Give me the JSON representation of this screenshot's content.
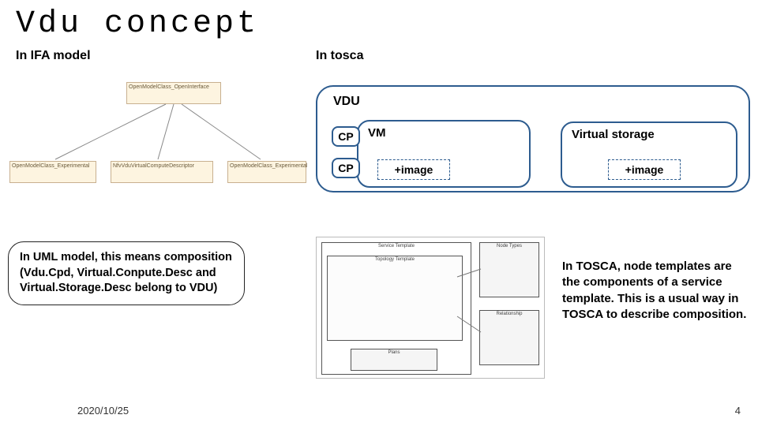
{
  "title": "Vdu concept",
  "subhead_left": "In IFA model",
  "subhead_right": "In tosca",
  "vdu": {
    "label": "VDU",
    "cp1": "CP",
    "cp2": "CP",
    "vm_label": "VM",
    "image1": "+image",
    "virtual_storage": "Virtual storage",
    "image2": "+image"
  },
  "left_bubble": "In UML model, this means composition (Vdu.Cpd, Virtual.Conpute.Desc and Virtual.Storage.Desc belong to VDU)",
  "right_text": "In TOSCA, node templates are the components of a service template. This is a usual way in TOSCA to describe composition.",
  "footer": {
    "date": "2020/10/25",
    "page": "4"
  }
}
